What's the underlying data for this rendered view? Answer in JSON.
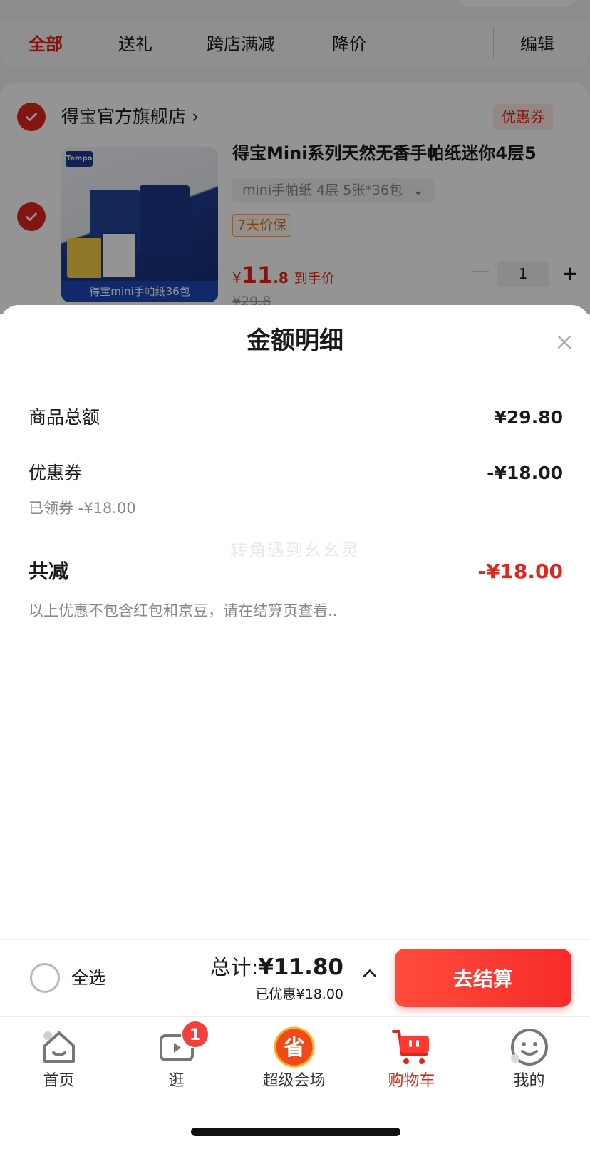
{
  "filter_bar": {
    "tabs": [
      "全部",
      "送礼",
      "跨店满减",
      "降价"
    ],
    "active_tab": "全部",
    "edit_label": "编辑"
  },
  "shop": {
    "name": "得宝官方旗舰店",
    "name_chevron": "›",
    "coupon_tag": "优惠券"
  },
  "product": {
    "image_brand": "Tempo",
    "image_caption": "得宝mini手帕纸36包",
    "title": "得宝Mini系列天然无香手帕纸迷你4层5",
    "spec": "mini手帕纸 4层 5张*36包",
    "price_protect_tag": "7天价保",
    "price_currency": "¥",
    "price_int": "11",
    "price_dec": ".8",
    "price_note": "到手价",
    "old_price": "¥29.8",
    "quantity": "1",
    "plus": "+"
  },
  "sheet": {
    "title": "金额明细",
    "rows": [
      {
        "label": "商品总额",
        "value": "¥29.80"
      },
      {
        "label": "优惠券",
        "value": "-¥18.00",
        "sub": "已领券 -¥18.00"
      }
    ],
    "watermark": "转角遇到幺幺灵",
    "total_reduce": {
      "label": "共减",
      "value": "-¥18.00"
    },
    "footnote": "以上优惠不包含红包和京豆，请在结算页查看.."
  },
  "checkout": {
    "select_all_label": "全选",
    "total_prefix": "总计:",
    "total_amount": "¥11.80",
    "saved_text": "已优惠¥18.00",
    "button_label": "去结算"
  },
  "tabbar": {
    "items": [
      {
        "label": "首页",
        "icon": "home-icon"
      },
      {
        "label": "逛",
        "icon": "video-play-icon",
        "badge": "1"
      },
      {
        "label": "超级会场",
        "icon": "super-venue-icon",
        "icon_text": "省"
      },
      {
        "label": "购物车",
        "icon": "cart-icon",
        "active": true
      },
      {
        "label": "我的",
        "icon": "profile-smile-icon"
      }
    ]
  },
  "colors": {
    "accent": "#e1251b",
    "button": "#f72b2b",
    "badge": "#f0413a"
  }
}
